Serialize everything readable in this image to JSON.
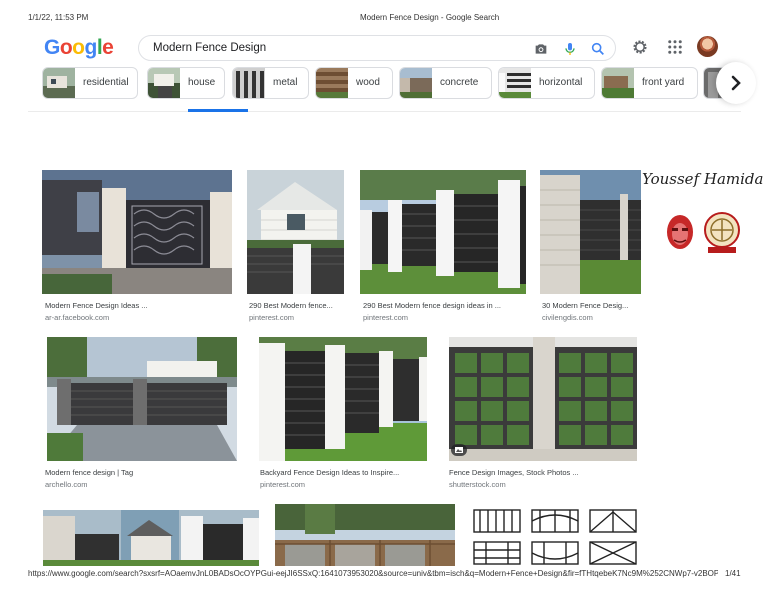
{
  "print_header": {
    "datetime": "1/1/22, 11:53 PM",
    "page_title": "Modern Fence Design - Google Search"
  },
  "logo": {
    "letters": [
      "G",
      "o",
      "o",
      "g",
      "l",
      "e"
    ],
    "colors": [
      "#4285f4",
      "#ea4335",
      "#fbbc05",
      "#4285f4",
      "#34a853",
      "#ea4335"
    ]
  },
  "search": {
    "query": "Modern Fence Design"
  },
  "icons": {
    "camera": "camera-icon",
    "mic": "microphone-icon",
    "search": "search-icon",
    "settings": "gear-icon",
    "apps": "apps-grid-icon",
    "next": "chevron-right-icon"
  },
  "chips": [
    {
      "label": "residential"
    },
    {
      "label": "house"
    },
    {
      "label": "metal"
    },
    {
      "label": "wood"
    },
    {
      "label": "concrete"
    },
    {
      "label": "horizontal"
    },
    {
      "label": "front yard"
    }
  ],
  "results": [
    {
      "caption": "Modern Fence Design Ideas ...",
      "source": "ar-ar.facebook.com"
    },
    {
      "caption": "290 Best Modern fence...",
      "source": "pinterest.com"
    },
    {
      "caption": "290 Best Modern fence design ideas in ...",
      "source": "pinterest.com"
    },
    {
      "caption": "30 Modern Fence Desig...",
      "source": "civilengdis.com"
    },
    {
      "caption": "Modern fence design | Tag",
      "source": "archello.com"
    },
    {
      "caption": "Backyard Fence Design Ideas to Inspire...",
      "source": "pinterest.com"
    },
    {
      "caption": "Fence Design Images, Stock Photos ...",
      "source": "shutterstock.com"
    }
  ],
  "watermark": {
    "name": "Youssef Hamida"
  },
  "print_footer": {
    "url": "https://www.google.com/search?sxsrf=AOaemvJnL0BADsOcOYPGui-eejJI6SSxQ:1641073953020&source=univ&tbm=isch&q=Modern+Fence+Design&fir=fTHtqebeK7Nc9M%252CNWp7-v2BOPGK...",
    "page": "1/41"
  },
  "colors": {
    "accent": "#1a73e8",
    "text": "#202124",
    "secondary": "#70757a"
  }
}
